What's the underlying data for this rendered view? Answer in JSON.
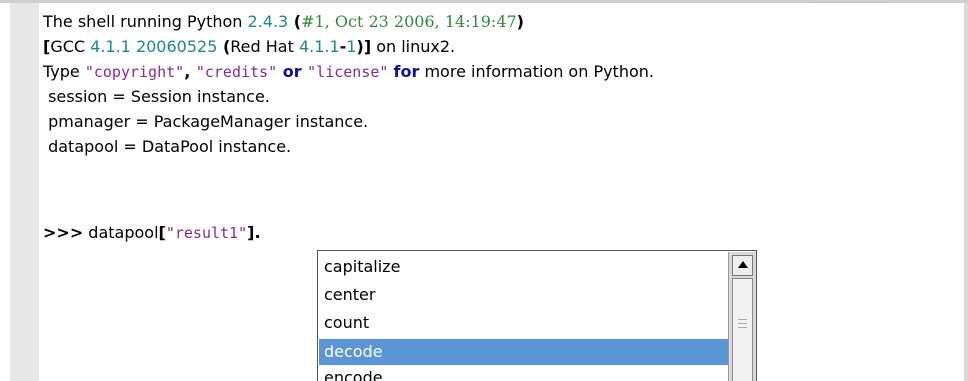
{
  "console": {
    "line1": {
      "prefix": "The shell running Python ",
      "version": "2.4.3",
      "paren_open": " (",
      "build": "#1, Oct 23 2006, 14:19:47",
      "paren_close": ")"
    },
    "line2": {
      "open": "[",
      "gcc": "GCC ",
      "gcc_ver": "4.1.1 20060525",
      "rh_open": " (",
      "rh": "Red Hat ",
      "rh_ver1": "4.1.1",
      "dash": "-",
      "rh_ver2": "1",
      "close": ")]",
      "suffix": " on linux2."
    },
    "line3": {
      "type": "Type ",
      "s1": "\"copyright\"",
      "comma": ", ",
      "s2": "\"credits\"",
      "or": " or ",
      "s3": "\"license\"",
      "sp": " ",
      "for": "for",
      "rest": " more information on Python."
    },
    "line4": " session = Session instance.",
    "line5": " pmanager = PackageManager instance.",
    "line6": " datapool = DataPool instance.",
    "prompt": {
      "chevrons": ">>>",
      "text": " datapool",
      "br_open": "[",
      "str": "\"result1\"",
      "br_close": "]",
      "dot": "."
    }
  },
  "completion": {
    "items": [
      "capitalize",
      "center",
      "count",
      "decode",
      "encode"
    ],
    "selected": "decode"
  },
  "icons": {
    "scroll_up": "arrow-up-icon"
  }
}
